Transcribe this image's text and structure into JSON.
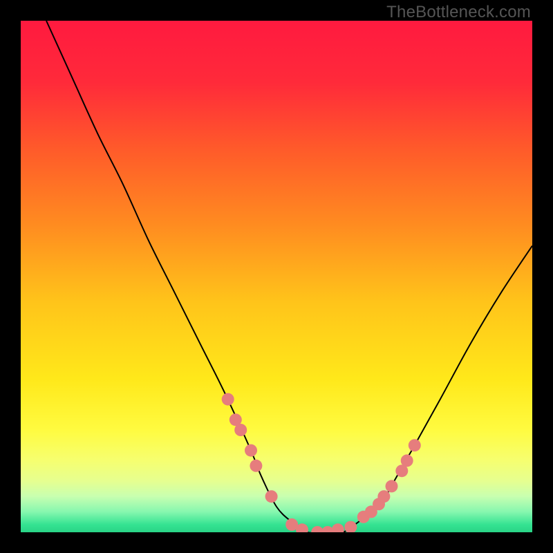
{
  "watermark": "TheBottleneck.com",
  "chart_data": {
    "type": "line",
    "title": "",
    "xlabel": "",
    "ylabel": "",
    "xlim": [
      0,
      100
    ],
    "ylim": [
      0,
      100
    ],
    "gradient_stops": [
      {
        "offset": 0.0,
        "color": "#ff1a3f"
      },
      {
        "offset": 0.12,
        "color": "#ff2a3a"
      },
      {
        "offset": 0.25,
        "color": "#ff5a2a"
      },
      {
        "offset": 0.4,
        "color": "#ff8c20"
      },
      {
        "offset": 0.55,
        "color": "#ffc41a"
      },
      {
        "offset": 0.7,
        "color": "#ffe81a"
      },
      {
        "offset": 0.8,
        "color": "#fffb40"
      },
      {
        "offset": 0.86,
        "color": "#f6ff70"
      },
      {
        "offset": 0.9,
        "color": "#e6ff90"
      },
      {
        "offset": 0.93,
        "color": "#c8ffb0"
      },
      {
        "offset": 0.96,
        "color": "#86f7af"
      },
      {
        "offset": 0.985,
        "color": "#35e392"
      },
      {
        "offset": 1.0,
        "color": "#29d487"
      }
    ],
    "series": [
      {
        "name": "bottleneck-curve",
        "x": [
          5,
          10,
          15,
          20,
          25,
          30,
          35,
          40,
          45,
          47,
          50,
          53,
          56,
          60,
          63,
          66,
          70,
          73,
          77,
          82,
          88,
          94,
          100
        ],
        "y": [
          100,
          89,
          78,
          68,
          57,
          47,
          37,
          27,
          16,
          11,
          5,
          2,
          0,
          0,
          0,
          2,
          5,
          10,
          17,
          26,
          37,
          47,
          56
        ]
      }
    ],
    "markers": {
      "name": "highlight-points",
      "color": "#e67d7d",
      "radius": 9,
      "points": [
        {
          "x": 40.5,
          "y": 26
        },
        {
          "x": 42.0,
          "y": 22
        },
        {
          "x": 43.0,
          "y": 20
        },
        {
          "x": 45.0,
          "y": 16
        },
        {
          "x": 46.0,
          "y": 13
        },
        {
          "x": 49.0,
          "y": 7
        },
        {
          "x": 53.0,
          "y": 1.5
        },
        {
          "x": 55.0,
          "y": 0.5
        },
        {
          "x": 58.0,
          "y": 0
        },
        {
          "x": 60.0,
          "y": 0
        },
        {
          "x": 62.0,
          "y": 0.5
        },
        {
          "x": 64.5,
          "y": 1
        },
        {
          "x": 67.0,
          "y": 3
        },
        {
          "x": 68.5,
          "y": 4
        },
        {
          "x": 70.0,
          "y": 5.5
        },
        {
          "x": 71.0,
          "y": 7
        },
        {
          "x": 72.5,
          "y": 9
        },
        {
          "x": 74.5,
          "y": 12
        },
        {
          "x": 75.5,
          "y": 14
        },
        {
          "x": 77.0,
          "y": 17
        }
      ]
    }
  }
}
